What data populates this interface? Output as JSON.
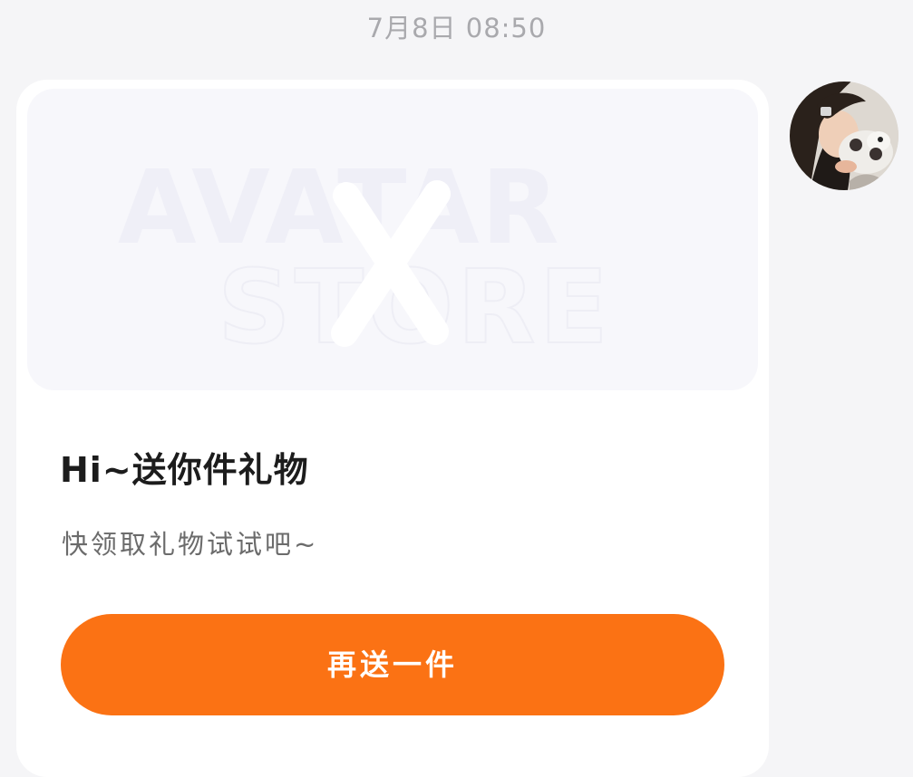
{
  "message": {
    "timestamp": "7月8日 08:50"
  },
  "gift_card": {
    "banner_logo_text_line1": "AVATAR",
    "banner_logo_text_line2": "STORE",
    "title": "Hi~送你件礼物",
    "subtitle": "快领取礼物试试吧~",
    "button_label": "再送一件"
  },
  "colors": {
    "page_background": "#f5f5f7",
    "card_background": "#ffffff",
    "banner_background": "#f7f7fb",
    "button_background": "#fb7214",
    "button_text": "#ffffff",
    "timestamp_text": "#a9a9ad",
    "title_text": "#1c1c1c",
    "subtitle_text": "#6b6b6b"
  }
}
